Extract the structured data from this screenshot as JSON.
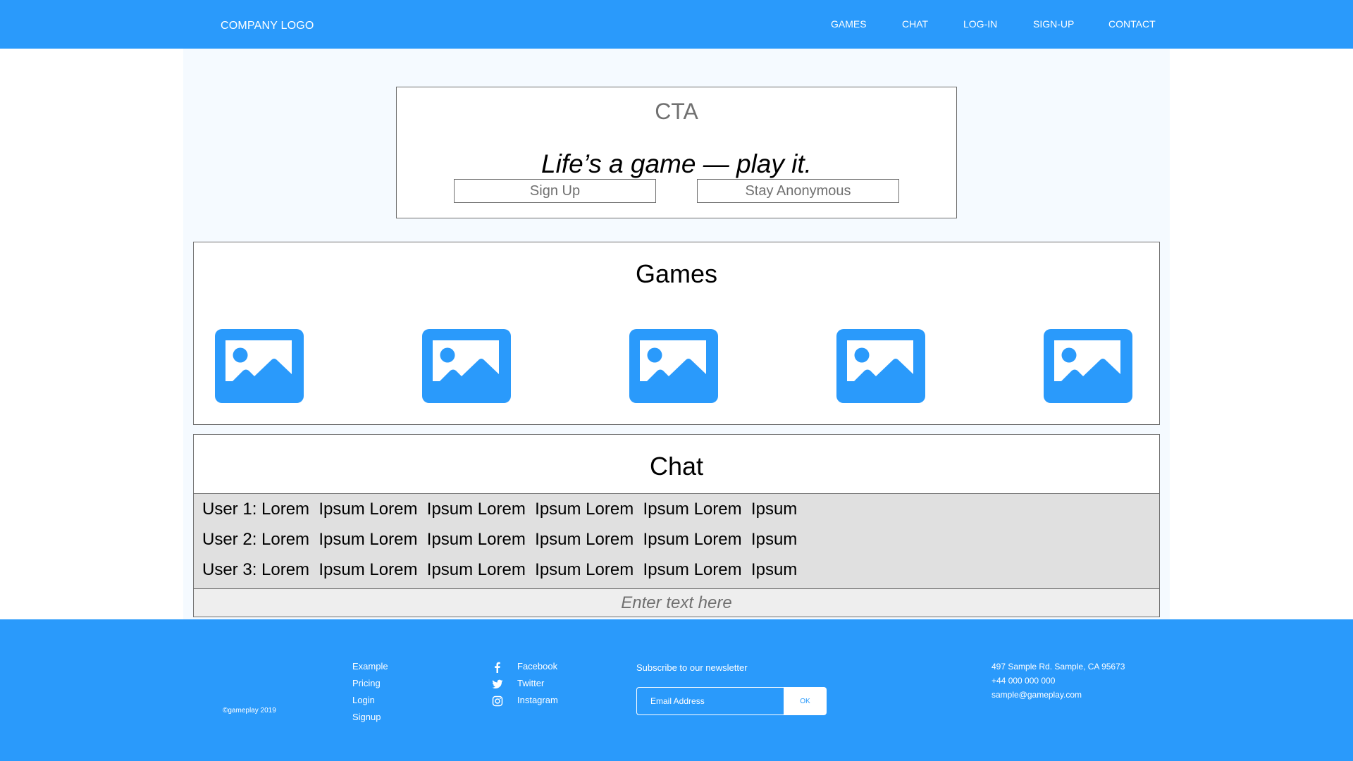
{
  "header": {
    "logo": "COMPANY LOGO",
    "nav": [
      {
        "label": "GAMES"
      },
      {
        "label": "CHAT"
      },
      {
        "label": "LOG-IN"
      },
      {
        "label": "SIGN-UP"
      },
      {
        "label": "CONTACT"
      }
    ]
  },
  "cta": {
    "title": "CTA",
    "tagline": "Life’s a game — play it.",
    "signup_label": "Sign Up",
    "anonymous_label": "Stay Anonymous"
  },
  "games": {
    "title": "Games",
    "items": [
      {
        "icon": "image-placeholder-icon"
      },
      {
        "icon": "image-placeholder-icon"
      },
      {
        "icon": "image-placeholder-icon"
      },
      {
        "icon": "image-placeholder-icon"
      },
      {
        "icon": "image-placeholder-icon"
      }
    ]
  },
  "chat": {
    "title": "Chat",
    "messages": [
      {
        "text": "User 1: Lorem  Ipsum Lorem  Ipsum Lorem  Ipsum Lorem  Ipsum Lorem  Ipsum"
      },
      {
        "text": "User 2: Lorem  Ipsum Lorem  Ipsum Lorem  Ipsum Lorem  Ipsum Lorem  Ipsum"
      },
      {
        "text": "User 3: Lorem  Ipsum Lorem  Ipsum Lorem  Ipsum Lorem  Ipsum Lorem  Ipsum"
      }
    ],
    "input_placeholder": "Enter text here",
    "input_value": ""
  },
  "footer": {
    "copyright": "©gameplay 2019",
    "links": [
      {
        "label": "Example"
      },
      {
        "label": "Pricing"
      },
      {
        "label": "Login"
      },
      {
        "label": "Signup"
      }
    ],
    "social": [
      {
        "label": "Facebook",
        "icon": "facebook-icon"
      },
      {
        "label": "Twitter",
        "icon": "twitter-icon"
      },
      {
        "label": "Instagram",
        "icon": "instagram-icon"
      }
    ],
    "newsletter": {
      "label": "Subscribe to our newsletter",
      "email_placeholder": "Email Address",
      "email_value": "",
      "submit_label": "OK"
    },
    "contact": {
      "address": "497 Sample Rd. Sample, CA 95673",
      "phone": "+44 000 000 000",
      "email": "sample@gameplay.com"
    }
  },
  "colors": {
    "brand_blue": "#2a9afb",
    "content_bg": "#f5faff",
    "chat_bg": "#e0e0e0",
    "input_bg": "#eeeeee",
    "border": "#6e6e6e"
  }
}
